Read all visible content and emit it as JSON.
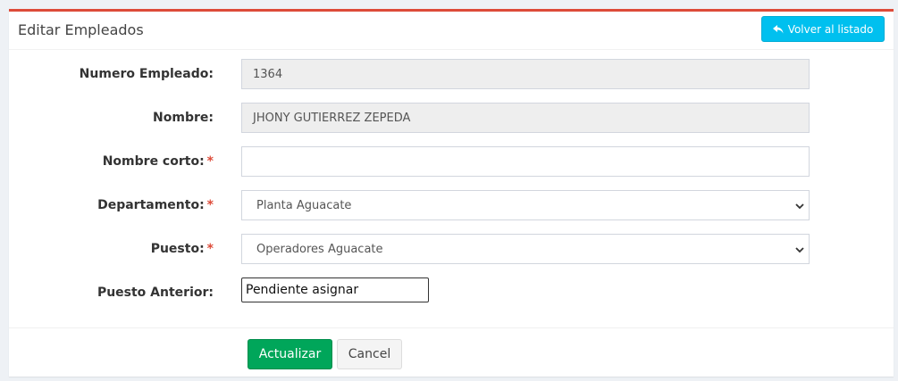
{
  "panel": {
    "title": "Editar Empleados",
    "back_button_label": "Volver al listado",
    "back_button_icon": "reply-icon"
  },
  "form": {
    "numero_empleado": {
      "label": "Numero Empleado:",
      "value": "1364"
    },
    "nombre": {
      "label": "Nombre:",
      "value": "JHONY GUTIERREZ ZEPEDA"
    },
    "nombre_corto": {
      "label": "Nombre corto:",
      "required_mark": "*",
      "value": ""
    },
    "departamento": {
      "label": "Departamento:",
      "required_mark": "*",
      "selected": "Planta Aguacate"
    },
    "puesto": {
      "label": "Puesto:",
      "required_mark": "*",
      "selected": "Operadores Aguacate"
    },
    "puesto_anterior": {
      "label": "Puesto Anterior:",
      "value": "Pendiente asignar"
    }
  },
  "footer": {
    "update_label": "Actualizar",
    "cancel_label": "Cancel"
  },
  "colors": {
    "top_border": "#dd4b39",
    "info_button": "#00c0ef",
    "success_button": "#00a65a",
    "required": "#dd4b39"
  }
}
